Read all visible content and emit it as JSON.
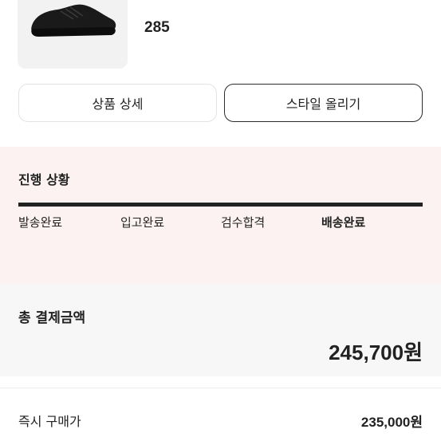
{
  "product": {
    "size": "285",
    "image": "black-running-shoe-image"
  },
  "buttons": {
    "detail_label": "상품 상세",
    "style_label": "스타일 올리기"
  },
  "progress": {
    "title": "진행 상황",
    "steps": [
      "발송완료",
      "입고완료",
      "검수합격",
      "배송완료"
    ],
    "current_step": "배송완료",
    "fill_fraction": 1.0
  },
  "payment": {
    "total_label": "총 결제금액",
    "total_amount": "245,700원",
    "instant_label": "즉시 구매가",
    "instant_amount": "235,000원"
  },
  "colors": {
    "progress_bg": "#fcf2f1",
    "bar": "#222222",
    "total_bg": "#f7f7f7"
  }
}
